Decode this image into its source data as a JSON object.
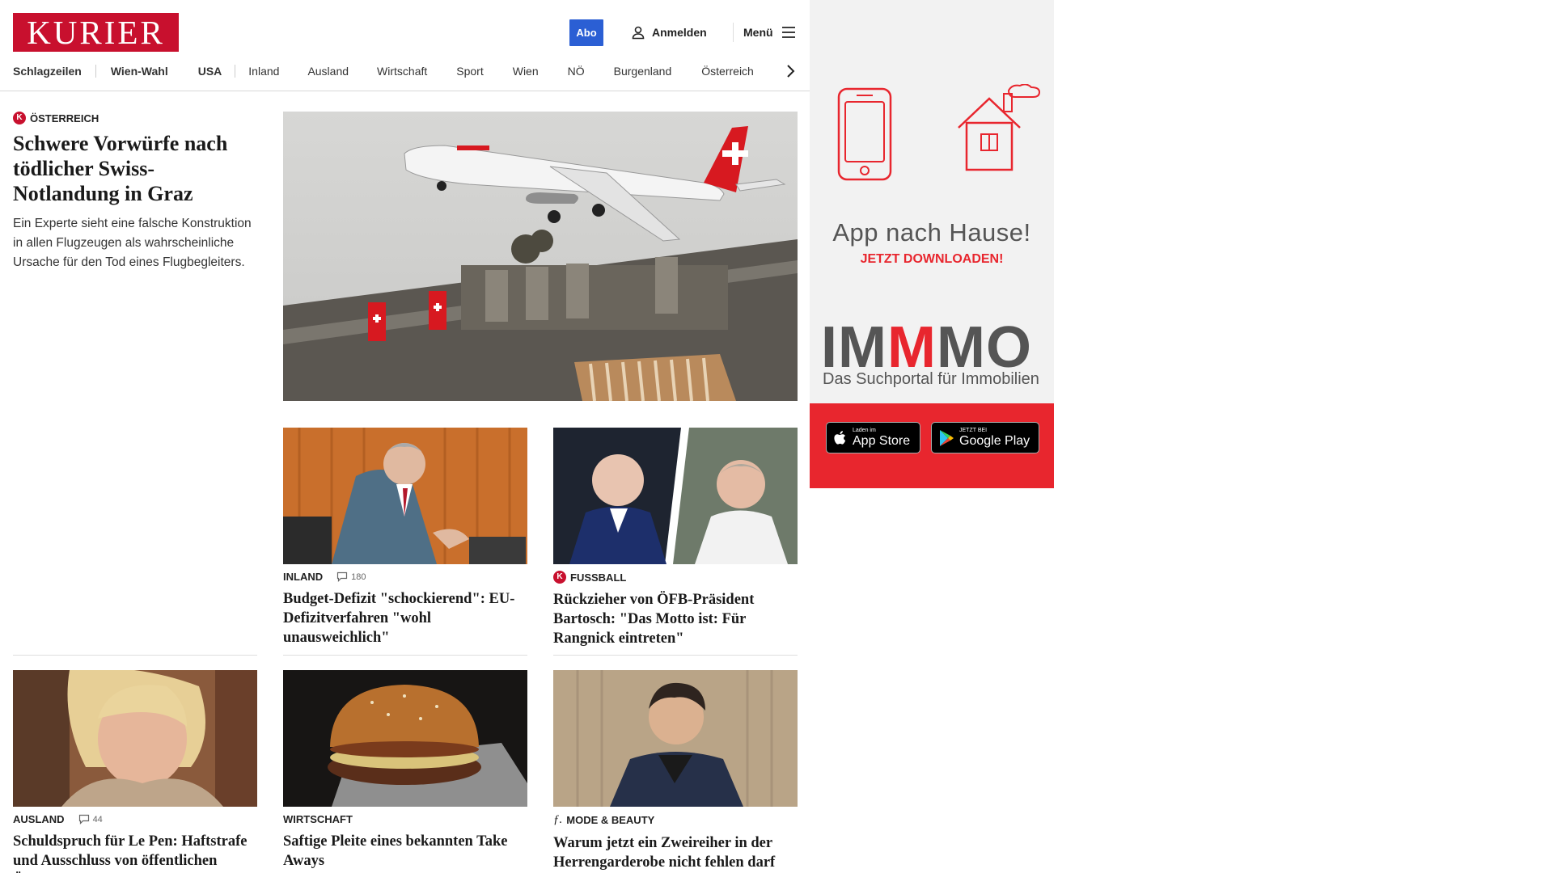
{
  "header": {
    "logo": "KURIER",
    "abo_label": "Abo",
    "login_label": "Anmelden",
    "menu_label": "Menü"
  },
  "nav": {
    "items": [
      "Schlagzeilen",
      "Wien-Wahl",
      "USA",
      "Inland",
      "Ausland",
      "Wirtschaft",
      "Sport",
      "Wien",
      "NÖ",
      "Burgenland",
      "Österreich"
    ]
  },
  "lead": {
    "kicker": "ÖSTERREICH",
    "title": "Schwere Vorwürfe nach tödlicher Swiss-Notlandung in Graz",
    "teaser": "Ein Experte sieht eine falsche Konstruktion in allen Flugzeugen als wahrscheinliche Ursache für den Tod eines Flugbegleiters."
  },
  "cards": [
    {
      "kicker": "INLAND",
      "comments": "180",
      "title": "Budget-Defizit \"schockierend\": EU-Defizitverfahren \"wohl unausweichlich\""
    },
    {
      "kicker": "FUSSBALL",
      "title": "Rückzieher von ÖFB-Präsident Bartosch: \"Das Motto ist: Für Rangnick eintreten\""
    },
    {
      "kicker": "AUSLAND",
      "comments": "44",
      "title": "Schuldspruch für Le Pen: Haftstrafe und Ausschluss von öffentlichen Ämtern"
    },
    {
      "kicker": "WIRTSCHAFT",
      "title": "Saftige Pleite eines bekannten Take Aways"
    },
    {
      "kicker": "MODE & BEAUTY",
      "title": "Warum jetzt ein Zweireiher in der Herrengarderobe nicht fehlen darf"
    }
  ],
  "ad": {
    "headline": "App nach Hause!",
    "subline": "JETZT DOWNLOADEN!",
    "brand_parts": [
      "IM",
      "M",
      "MO"
    ],
    "brand_sub": "Das Suchportal für Immobilien",
    "appstore_small": "Laden im",
    "appstore_big": "App Store",
    "googleplay_small": "JETZT BEI",
    "googleplay_big": "Google Play"
  },
  "colors": {
    "brand_red": "#c8102e",
    "abo_blue": "#2b5fd4",
    "ad_red": "#e8262e"
  }
}
